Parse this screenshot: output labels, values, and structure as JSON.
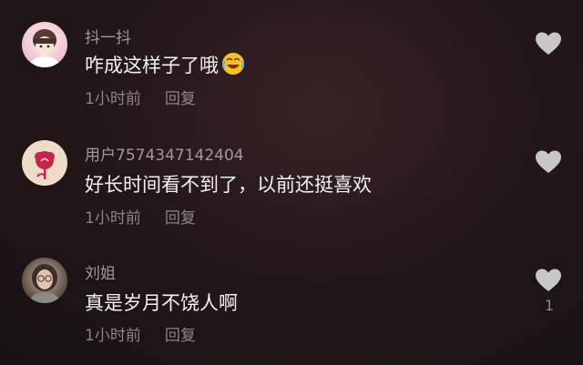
{
  "colors": {
    "background": "#1c1416",
    "username": "#9e9a9b",
    "content": "#f2f2f2",
    "meta": "#8a8687",
    "heart": "#c9c6c7"
  },
  "comments": [
    {
      "username": "抖一抖",
      "text": "咋成这样子了哦",
      "emoji": "laughing-crying-emoji",
      "time": "1小时前",
      "reply": "回复",
      "likes": ""
    },
    {
      "username": "用户7574347142404",
      "text": "好长时间看不到了，以前还挺喜欢",
      "time": "1小时前",
      "reply": "回复",
      "likes": ""
    },
    {
      "username": "刘姐",
      "text": "真是岁月不饶人啊",
      "time": "1小时前",
      "reply": "回复",
      "likes": "1"
    }
  ]
}
